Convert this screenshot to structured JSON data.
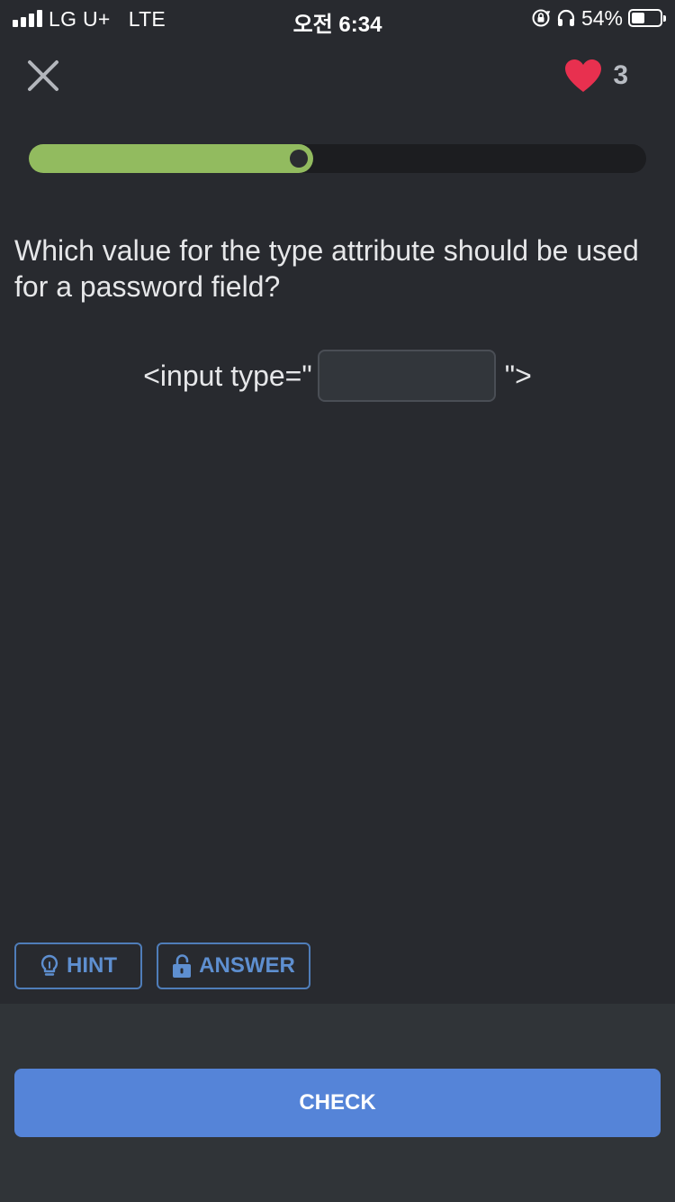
{
  "status_bar": {
    "carrier": "LG U+",
    "network": "LTE",
    "time": "오전 6:34",
    "battery_percent": "54%",
    "battery_level": 0.54
  },
  "header": {
    "lives": "3",
    "heart_color": "#e8304f"
  },
  "progress": {
    "fraction": 0.46,
    "color": "#92bb5f"
  },
  "question": {
    "text": "Which value for the type attribute should be used for a password field?",
    "code_prefix": "<input type=\"",
    "code_suffix": "\">",
    "input_value": "",
    "input_placeholder": ""
  },
  "actions": {
    "hint_label": "HINT",
    "answer_label": "ANSWER",
    "check_label": "CHECK",
    "accent": "#5584d8"
  }
}
